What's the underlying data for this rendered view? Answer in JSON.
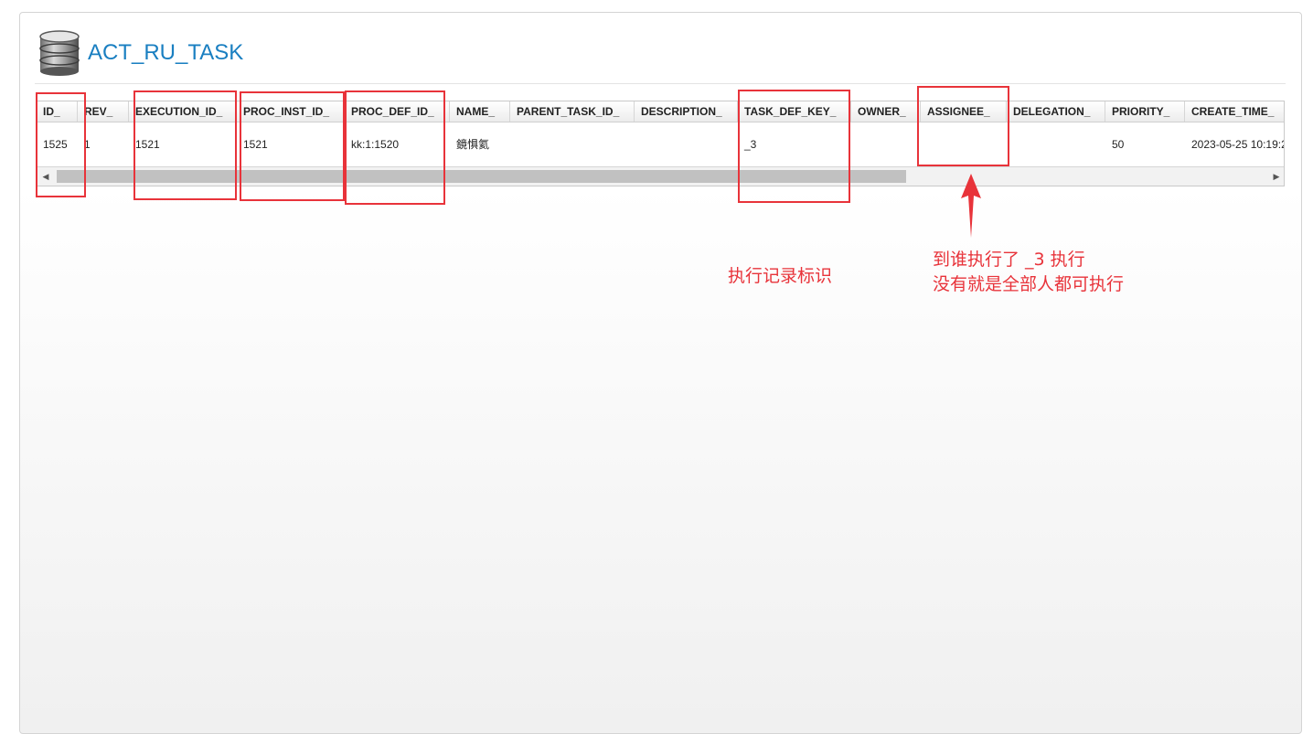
{
  "page": {
    "title": "ACT_RU_TASK",
    "icon": "database-icon"
  },
  "table": {
    "columns": [
      "ID_",
      "REV_",
      "EXECUTION_ID_",
      "PROC_INST_ID_",
      "PROC_DEF_ID_",
      "NAME_",
      "PARENT_TASK_ID_",
      "DESCRIPTION_",
      "TASK_DEF_KEY_",
      "OWNER_",
      "ASSIGNEE_",
      "DELEGATION_",
      "PRIORITY_",
      "CREATE_TIME_"
    ],
    "rows": [
      [
        "1525",
        "1",
        "1521",
        "1521",
        "kk:1:1520",
        "鏡惧氦",
        "",
        "",
        "_3",
        "",
        "",
        "",
        "50",
        "2023-05-25 10:19:2"
      ]
    ]
  },
  "annotations": {
    "label_task_def_key": "执行记录标识",
    "label_assignee_line1": "到谁执行了 _3 执行",
    "label_assignee_line2": "没有就是全部人都可执行",
    "color": "#e8333a"
  },
  "scrollbar": {
    "left_arrow": "◀",
    "right_arrow": "▶"
  }
}
